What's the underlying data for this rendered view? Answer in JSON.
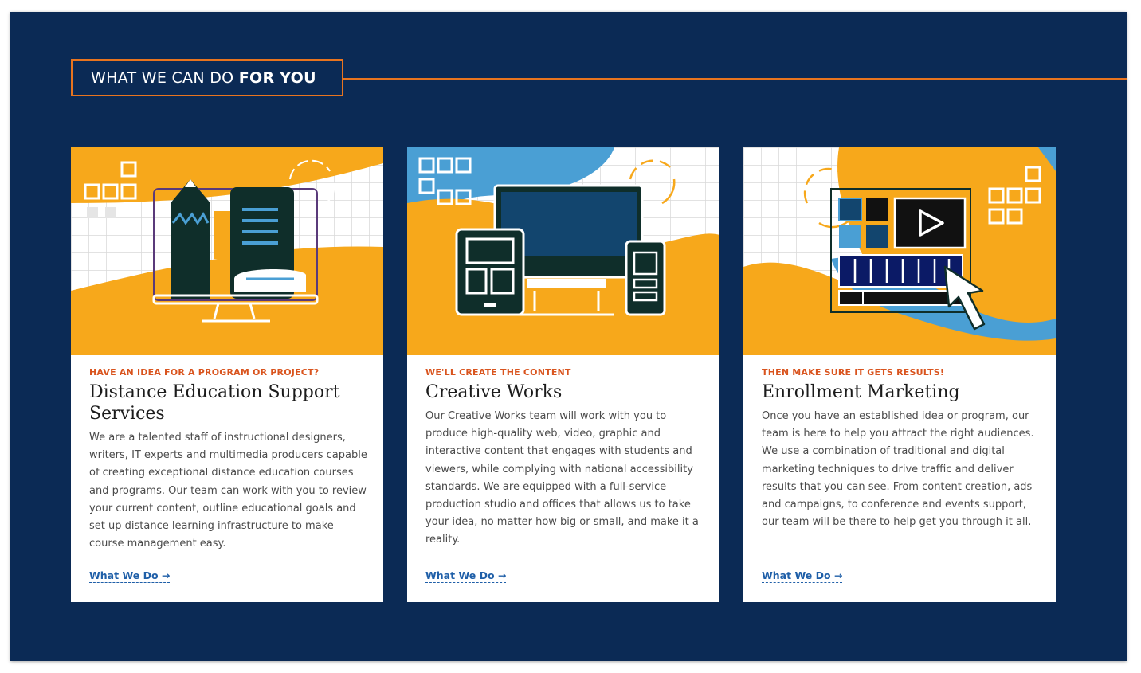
{
  "section": {
    "heading_regular": "WHAT WE CAN DO ",
    "heading_bold": "FOR YOU"
  },
  "cards": [
    {
      "eyebrow": "HAVE AN IDEA FOR A PROGRAM OR PROJECT?",
      "title": "Distance Education Support Services",
      "body": "We are a talented staff of instructional designers, writers, IT experts and multimedia producers capable of creating exceptional distance education courses and programs. Our team can work with you to review your current content, outline educational goals and set up distance learning infrastructure to make course management easy.",
      "link": "What We Do →",
      "icon": "computer-pencil-book-illustration"
    },
    {
      "eyebrow": "WE'LL CREATE THE CONTENT",
      "title": "Creative Works",
      "body": "Our Creative Works team will work with you to produce high-quality web, video, graphic and interactive content that engages with students and viewers, while complying with national accessibility standards. We are equipped with a full-service production studio and offices that allows us to take your idea, no matter how big or small, and make it a reality.",
      "link": "What We Do →",
      "icon": "devices-illustration"
    },
    {
      "eyebrow": "THEN MAKE SURE IT GETS RESULTS!",
      "title": "Enrollment Marketing",
      "body": "Once you have an established idea or program, our team is here to help you attract the right audiences. We use a combination of traditional and digital marketing techniques to drive traffic and deliver results that you can see. From content creation, ads and campaigns, to conference and events support, our team will be there to help get you through it all.",
      "link": "What We Do →",
      "icon": "video-player-cursor-illustration"
    }
  ],
  "colors": {
    "background": "#0b2a55",
    "accent_orange": "#e8741f",
    "illustration_yellow": "#f7a81b",
    "illustration_blue": "#4a9fd4",
    "dark_green": "#0f2e2a",
    "link_blue": "#1f5fa8",
    "eyebrow_red": "#d9541e"
  }
}
